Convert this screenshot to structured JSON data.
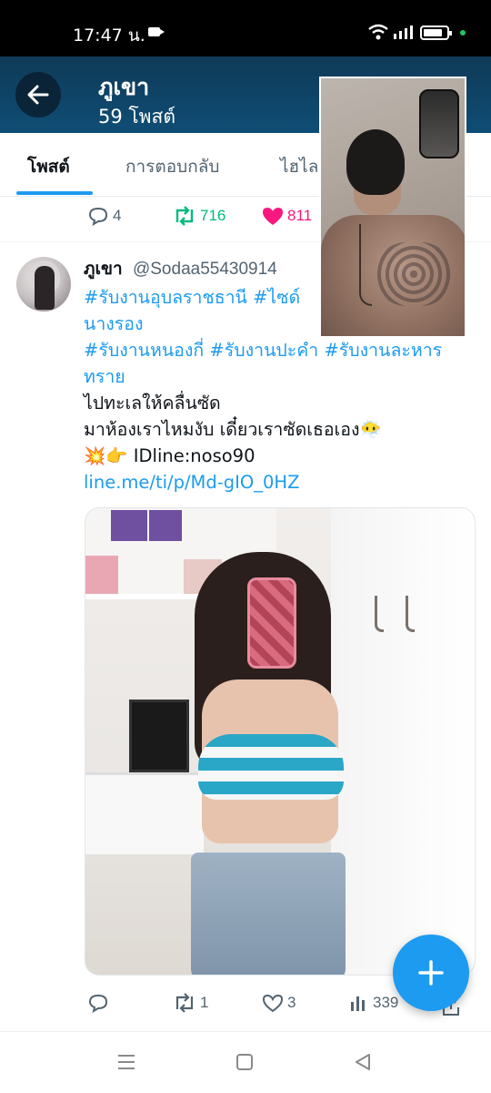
{
  "status_bar": {
    "time": "17:47 น."
  },
  "header": {
    "title": "ภูเขา",
    "subtitle": "59 โพสต์"
  },
  "tabs": [
    {
      "label": "โพสต์",
      "active": true
    },
    {
      "label": "การตอบกลับ",
      "active": false
    },
    {
      "label": "ไฮไลต์",
      "active": false
    }
  ],
  "previous_tweet": {
    "replies": "4",
    "retweets": "716",
    "likes": "811"
  },
  "tweet": {
    "name": "ภูเขา",
    "handle": "@Sodaa55430914",
    "lines": [
      "#รับงานอุบลราชธานี #ไซด์",
      "นางรอง",
      "#รับงานหนองกี่ #รับงานปะคำ #รับงานละหาร",
      "ทราย",
      "ไปทะเลให้คลื่นซัด",
      "มาห้องเราไหมงับ เดี๋ยวเราซัดเธอเอง😶‍🌫️",
      "💥👉 IDline:noso90",
      "line.me/ti/p/Md-gIO_0HZ"
    ],
    "actions": {
      "replies": "",
      "retweets": "1",
      "likes": "3",
      "views": "339"
    }
  },
  "colors": {
    "accent": "#1d9bf0",
    "header_bg": "#0f4d75",
    "retweet": "#00ba7c",
    "like": "#f91880"
  },
  "icons": [
    "back-arrow-icon",
    "reply-icon",
    "retweet-icon",
    "heart-icon",
    "views-icon",
    "share-icon",
    "compose-plus-icon",
    "menu-icon",
    "home-icon",
    "back-icon"
  ]
}
